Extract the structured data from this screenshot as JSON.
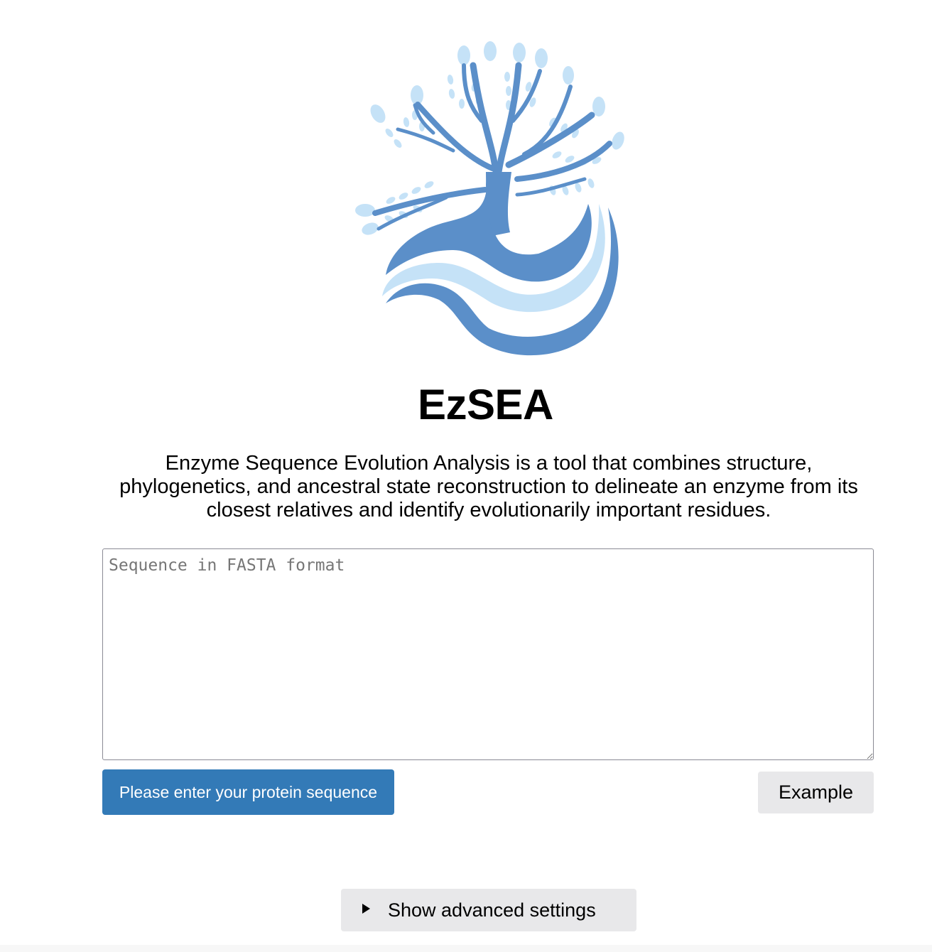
{
  "header": {
    "logo_icon": "enzyme-tree-logo-icon",
    "title": "EzSEA",
    "description": "Enzyme Sequence Evolution Analysis is a tool that combines structure, phylogenetics, and ancestral state reconstruction to delineate an enzyme from its closest relatives and identify evolutionarily important residues."
  },
  "form": {
    "sequence_value": "",
    "sequence_placeholder": "Sequence in FASTA format",
    "submit_label": "Please enter your protein sequence",
    "example_label": "Example",
    "advanced_label": "Show advanced settings"
  },
  "colors": {
    "primary": "#337ab7",
    "logo_dark": "#5b8fc9",
    "logo_light": "#c5e2f7",
    "button_gray": "#e8e8ea"
  }
}
